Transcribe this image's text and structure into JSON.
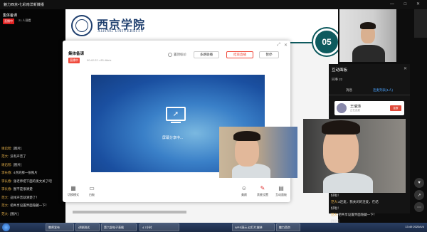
{
  "window": {
    "title": "魅力西京•七彩南洋新媒播",
    "controls": "— □ ✕"
  },
  "left_panel": {
    "host": "集体备课",
    "live_badge": "直播中",
    "viewers": "21 人观看",
    "chat": [
      {
        "name": "谢启智:",
        "msg": "[图片]"
      },
      {
        "name": "范大:",
        "msg": "没有声音了"
      },
      {
        "name": "谢启智:",
        "msg": "[图片]"
      },
      {
        "name": "李长春:",
        "msg": "4点的那一张照片"
      },
      {
        "name": "李长春:",
        "msg": "张老师把下面的发文关了吧"
      },
      {
        "name": "李长春:",
        "msg": "图不是很清楚"
      },
      {
        "name": "范大:",
        "msg": "这样声音就清楚了！"
      },
      {
        "name": "范大:",
        "msg": "把共享设置界面隐藏一下！"
      },
      {
        "name": "范大:",
        "msg": "[图片]"
      }
    ]
  },
  "slide": {
    "logo_cn": "西京学院",
    "logo_en": "XIJING UNIVERSITY",
    "page_number": "05"
  },
  "dialog": {
    "title": "集体备课",
    "live_badge": "直播中",
    "time_info": "00:42:22  •  83.4kb/s",
    "pinned_label": "置顶标价",
    "multi_btn": "多路联播",
    "end_btn": "结束直播",
    "pause_btn": "暂停",
    "share_text": "屏幕分享中...",
    "tools": [
      {
        "label": "切换模式",
        "icon": "grid-icon"
      },
      {
        "label": "白板",
        "icon": "whiteboard-icon"
      },
      {
        "label": "美颜",
        "icon": "beauty-icon"
      },
      {
        "label": "禁麦设置",
        "icon": "mic-off-icon"
      },
      {
        "label": "互动面板",
        "icon": "chat-panel-icon"
      }
    ]
  },
  "interact": {
    "title": "互动面板",
    "stats": "同事 22",
    "tabs": [
      "消息",
      "连麦列表(1人)"
    ],
    "guest_name": "王瑞涛",
    "guest_sub": "正在连麦",
    "guest_action": "挂断"
  },
  "right_chat": [
    {
      "name": "",
      "msg": "好啦！"
    },
    {
      "name": "范大:",
      "msg": "a连麦，我关闭的连麦，在结"
    },
    {
      "name": "",
      "msg": "好啦！"
    },
    {
      "name": "范大:",
      "msg": "把共享设置界面隐藏一下！"
    },
    {
      "name": "",
      "msg": "[图片]"
    }
  ],
  "taskbar": {
    "items": [
      "教师发布",
      "讲课测试",
      "第六部电子表格",
      "4.7小时",
      "WPS演示-幻灯片放映",
      "魅力西京"
    ],
    "tray": "13:49 2020/4/4"
  },
  "colors": {
    "accent": "#0e5a5e",
    "live_red": "#e02020",
    "brand_blue": "#1f3f6e"
  }
}
